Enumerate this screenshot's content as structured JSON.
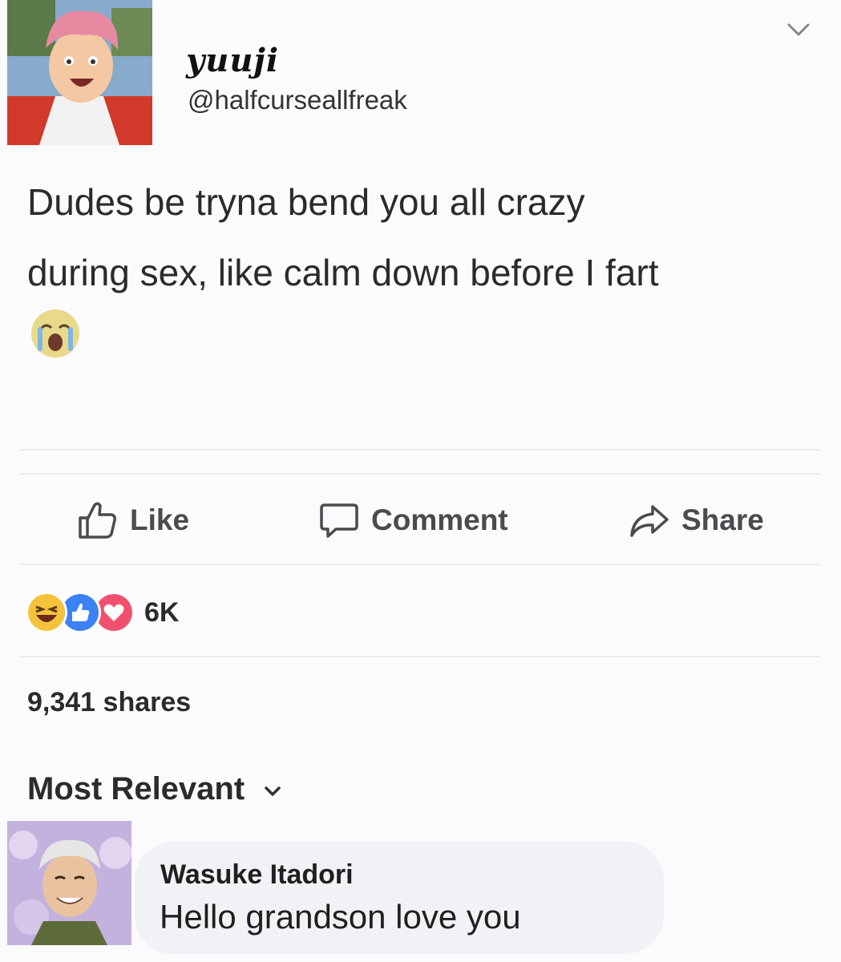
{
  "post": {
    "display_name": "yuuji",
    "handle": "@halfcurseallfreak",
    "text_line1": "Dudes be tryna bend you all crazy",
    "text_line2": "during sex, like calm down before I fart",
    "emoji": "loudly-crying-face"
  },
  "actions": {
    "like": "Like",
    "comment": "Comment",
    "share": "Share"
  },
  "reactions": {
    "types": [
      "laughing",
      "like",
      "love"
    ],
    "count": "6K"
  },
  "shares": "9,341 shares",
  "sort": {
    "label": "Most Relevant"
  },
  "comment": {
    "author": "Wasuke Itadori",
    "text": "Hello grandson love you"
  },
  "colors": {
    "like_blue": "#3b82f6",
    "love_red": "#f0506e",
    "haha_yellow": "#f5c33b",
    "bubble_bg": "#f1f2f6"
  }
}
